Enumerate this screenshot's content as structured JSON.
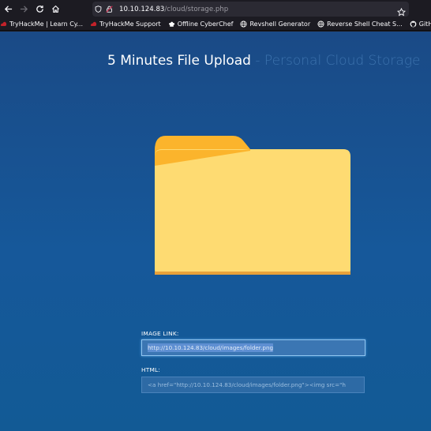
{
  "browser": {
    "url_host": "10.10.124.83",
    "url_path": "/cloud/storage.php",
    "bookmarks": [
      {
        "label": "TryHackMe | Learn Cy...",
        "icon": "tryhackme-icon",
        "color": "#c3222a"
      },
      {
        "label": "TryHackMe Support",
        "icon": "tryhackme-icon",
        "color": "#c3222a"
      },
      {
        "label": "Offline CyberChef",
        "icon": "chef-hat-icon",
        "color": "#ffffff"
      },
      {
        "label": "Revshell Generator",
        "icon": "globe-icon",
        "color": "#ffffff"
      },
      {
        "label": "Reverse Shell Cheat S...",
        "icon": "globe-icon",
        "color": "#ffffff"
      },
      {
        "label": "GitHub - swi",
        "icon": "github-icon",
        "color": "#ffffff"
      }
    ]
  },
  "page": {
    "title_main": "5 Minutes File Upload",
    "title_sep": " - ",
    "title_sub": "Personal Cloud Storage",
    "image_link_label": "IMAGE LINK:",
    "image_link_value": "http://10.10.124.83/cloud/images/folder.png",
    "html_label": "HTML:",
    "html_value": "<a href=\"http://10.10.124.83/cloud/images/folder.png\"><img src=\"h"
  },
  "colors": {
    "page_bg_top": "#1a4a86",
    "page_bg_bottom": "#125a95",
    "folder_tab": "#fbb42c",
    "folder_body": "#fedb72",
    "folder_edge": "#e8a13a"
  }
}
